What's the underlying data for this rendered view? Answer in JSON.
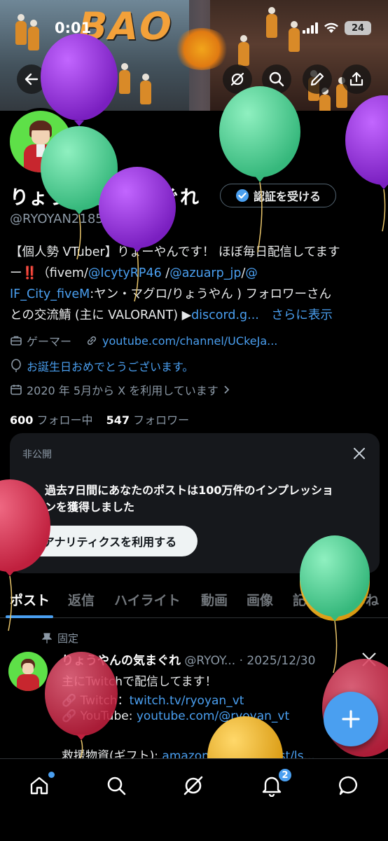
{
  "status": {
    "time": "0:01",
    "battery": "24"
  },
  "banner": {
    "logo_text": "BAO"
  },
  "profile": {
    "name": "りょうやんの気まぐれ",
    "verify_label": "認証を受ける",
    "handle": "@RYOYAN21852061",
    "bio": {
      "line1": "【個人勢 VTuber】りょーやんです！ ほぼ毎日配信してます",
      "line2_prefix": "ー‼️（fivem/",
      "mention1": "@IcytyRP46",
      "line2_sep": " /",
      "mention2": "@azuarp_jp",
      "line2_sep2": "/",
      "mention3_a": "@",
      "mention3_b": "IF_City_fiveM",
      "line3_rest": ":ヤン・マグロ/りょうやん ) フォロワーさん",
      "line4_prefix": "との交流鯖 (主に VALORANT) ▶",
      "discord_link": "discord.g...",
      "show_more": "さらに表示"
    },
    "category": "ゲーマー",
    "url": "youtube.com/channel/UCkeJa...",
    "birthday": "お誕生日おめでとうございます。",
    "joined": "2020 年 5月から X を利用しています",
    "following_count": "600",
    "following_label": "フォロー中",
    "followers_count": "547",
    "followers_label": "フォロワー"
  },
  "private_card": {
    "label": "非公開",
    "message_line1": "過去7日間にあなたのポストは100万件のインプレッショ",
    "message_line2": "ンを獲得しました",
    "button": "アナリティクスを利用する"
  },
  "tabs": [
    "ポスト",
    "返信",
    "ハイライト",
    "動画",
    "画像",
    "記事",
    "いいね"
  ],
  "pinned": {
    "label": "固定",
    "name": "りょうやんの気まぐれ",
    "handle_date": "@RYOY... · 2025/12/30",
    "line1": "主にTwitchで配信してます！",
    "twitch_label": "Twitch：",
    "twitch_link": "twitch.tv/ryoyan_vt",
    "youtube_label": "YouTube: ",
    "youtube_link": "youtube.com/@ryoyan_vt",
    "gift_label": "救援物資(ギフト): ",
    "gift_link": "amazon.jp/hz/wishlist/ls..."
  },
  "nav": {
    "notification_badge": "2"
  },
  "colors": {
    "accent": "#4a9ff0",
    "avatar_bg": "#5ee048"
  }
}
